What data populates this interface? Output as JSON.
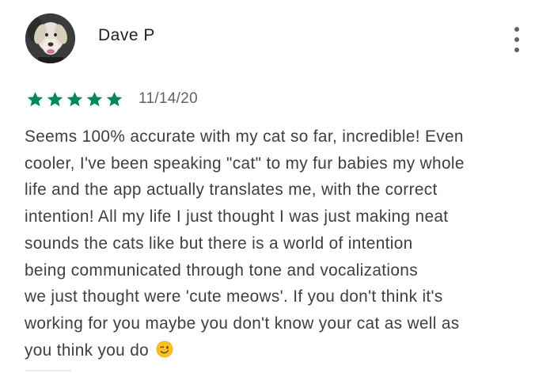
{
  "review": {
    "author": "Dave P",
    "rating": 5,
    "rating_max": 5,
    "date": "11/14/20",
    "body_lines": [
      "Seems 100% accurate with my cat so far, incredible! Even",
      "cooler, I've been speaking \"cat\" to my fur babies my whole",
      "life and the app actually translates me, with the correct",
      "intention! All my life I just thought I was just making neat",
      "sounds the cats like but there is a world of intention",
      "being communicated through tone and vocalizations",
      "we just thought were 'cute meows'. If you don't think it's",
      "working for you maybe you don't know your cat as well as",
      "you think you do"
    ],
    "emoji": "winking-face",
    "star_color": "#01875f",
    "icons": {
      "avatar": "dog-avatar",
      "menu": "more-vertical-icon",
      "star": "star-icon"
    }
  }
}
